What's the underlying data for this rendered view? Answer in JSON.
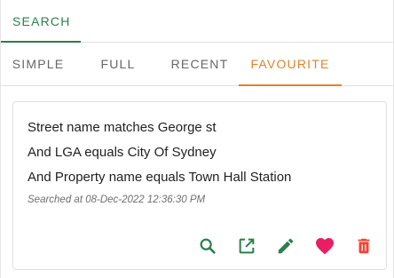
{
  "colors": {
    "green": "#2e7d4f",
    "orange": "#e0822b",
    "gray_tab": "#666666",
    "pink": "#e91e63",
    "red": "#f44336"
  },
  "top_tabs": {
    "search_label": "SEARCH"
  },
  "sub_tabs": {
    "simple": "SIMPLE",
    "full": "FULL",
    "recent": "RECENT",
    "favourite": "FAVOURITE",
    "active": "favourite"
  },
  "card": {
    "line1": "Street name matches George st",
    "line2": "And LGA equals City Of Sydney",
    "line3": "And Property name equals Town Hall Station",
    "timestamp": "Searched at 08-Dec-2022 12:36:30 PM",
    "actions": {
      "search_icon": "search-icon",
      "open_icon": "open-in-new-icon",
      "edit_icon": "pencil-icon",
      "favourite_icon": "heart-icon",
      "delete_icon": "trash-icon"
    }
  }
}
